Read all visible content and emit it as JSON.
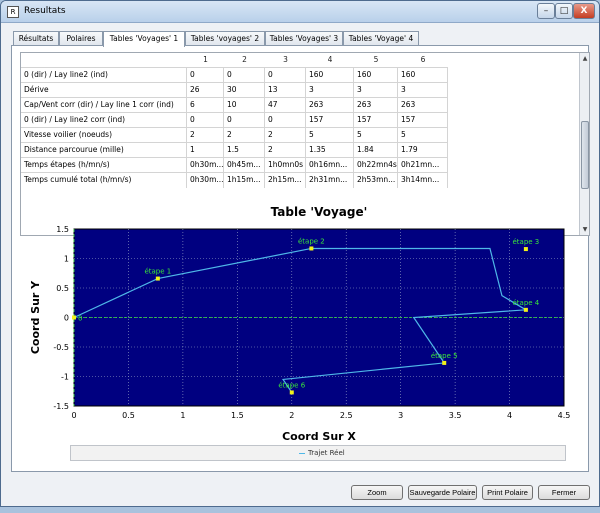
{
  "window": {
    "title": "Resultats",
    "app_icon": "R",
    "controls": {
      "minimize": "–",
      "maximize": "□",
      "close": "X"
    }
  },
  "tabs": [
    {
      "label": "Résultats",
      "active": false
    },
    {
      "label": "Polaires",
      "active": false
    },
    {
      "label": "Tables 'Voyages' 1",
      "active": true
    },
    {
      "label": "Tables 'voyages' 2",
      "active": false
    },
    {
      "label": "Tables 'Voyages' 3",
      "active": false
    },
    {
      "label": "Tables 'Voyage' 4",
      "active": false
    }
  ],
  "table": {
    "columns": [
      "1",
      "2",
      "3",
      "4",
      "5",
      "6"
    ],
    "rows": [
      {
        "label": "0 (dir) / Lay line2 (ind)",
        "values": [
          "0",
          "0",
          "0",
          "160",
          "160",
          "160"
        ]
      },
      {
        "label": "Dérive",
        "values": [
          "26",
          "30",
          "13",
          "3",
          "3",
          "3"
        ]
      },
      {
        "label": "Cap/Vent corr (dir) / Lay line 1 corr (ind)",
        "values": [
          "6",
          "10",
          "47",
          "263",
          "263",
          "263"
        ]
      },
      {
        "label": "0 (dir) / Lay line2 corr (ind)",
        "values": [
          "0",
          "0",
          "0",
          "157",
          "157",
          "157"
        ]
      },
      {
        "label": "Vitesse voilier (noeuds)",
        "values": [
          "2",
          "2",
          "2",
          "5",
          "5",
          "5"
        ]
      },
      {
        "label": "Distance parcourue (mille)",
        "values": [
          "1",
          "1.5",
          "2",
          "1.35",
          "1.84",
          "1.79"
        ]
      },
      {
        "label": "Temps étapes (h/mn/s)",
        "values": [
          "0h30m...",
          "0h45m...",
          "1h0mn0s",
          "0h16mn...",
          "0h22mn4s",
          "0h21mn..."
        ]
      },
      {
        "label": "Temps cumulé total (h/mn/s)",
        "values": [
          "0h30m...",
          "1h15m...",
          "2h15m...",
          "2h31mn...",
          "2h53mn...",
          "3h14mn..."
        ]
      }
    ],
    "scroll_up": "▲",
    "scroll_down": "▼"
  },
  "chart_data": {
    "type": "line",
    "title": "Table 'Voyage'",
    "xlabel": "Coord Sur X",
    "ylabel": "Coord Sur Y",
    "xlim": [
      0,
      4.5
    ],
    "ylim": [
      -1.5,
      1.5
    ],
    "xticks": [
      "0",
      "0.5",
      "1",
      "1.5",
      "2",
      "2.5",
      "3",
      "3.5",
      "4",
      "4.5"
    ],
    "yticks": [
      "1.5",
      "1",
      "0.5",
      "0",
      "-0.5",
      "-1",
      "-1.5"
    ],
    "grid": true,
    "legend": "bottom",
    "series": [
      {
        "name": "Trajet Réel",
        "x": [
          0,
          0.77,
          2.18,
          3.82,
          3.93,
          4.15,
          3.12,
          3.4,
          1.92,
          2.0
        ],
        "y": [
          0,
          0.66,
          1.17,
          1.17,
          0.37,
          0.13,
          0.0,
          -0.77,
          -1.05,
          -1.27
        ]
      }
    ],
    "waypoints": [
      {
        "label": "0",
        "x": 0,
        "y": 0
      },
      {
        "label": "étape 1",
        "x": 0.77,
        "y": 0.66
      },
      {
        "label": "étape 2",
        "x": 2.18,
        "y": 1.17
      },
      {
        "label": "étape 3",
        "x": 4.15,
        "y": 1.16
      },
      {
        "label": "étape 4",
        "x": 4.15,
        "y": 0.13
      },
      {
        "label": "étape 5",
        "x": 3.4,
        "y": -0.77
      },
      {
        "label": "étape 6",
        "x": 2.0,
        "y": -1.27
      }
    ],
    "colors": {
      "plot_bg": "#000080",
      "line": "#4fb8e8",
      "label": "#39e639",
      "marker": "#f2f21a",
      "grid": "#9aa6c8"
    }
  },
  "buttons": {
    "zoom": "Zoom",
    "save_polar": "Sauvegarde Polaire",
    "print_polar": "Print Polaire",
    "close": "Fermer"
  }
}
